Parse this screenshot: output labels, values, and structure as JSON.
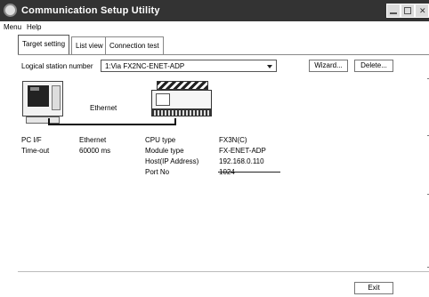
{
  "window": {
    "title": "Communication Setup Utility",
    "icons": {
      "app": "app-icon",
      "minimize": "minimize-icon",
      "maximize": "maximize-icon",
      "close": "close-icon"
    }
  },
  "menu": {
    "items": [
      "Menu",
      "Help"
    ]
  },
  "tabs": [
    {
      "label": "Target setting",
      "active": true
    },
    {
      "label": "List view",
      "active": false
    },
    {
      "label": "Connection test",
      "active": false
    }
  ],
  "target": {
    "station_label": "Logical station number",
    "station_value": "1:Via FX2NC-ENET-ADP",
    "wizard_label": "Wizard...",
    "delete_label": "Delete..."
  },
  "diagram": {
    "network_label": "Ethernet",
    "pc_icon": "pc-icon",
    "plc_icon": "plc-icon"
  },
  "details": {
    "pc_if_label": "PC I/F",
    "pc_if_value": "Ethernet",
    "timeout_label": "Time-out",
    "timeout_value": "60000 ms",
    "cpu_type_label": "CPU type",
    "cpu_type_value": "FX3N(C)",
    "module_type_label": "Module type",
    "module_type_value": "FX-ENET-ADP",
    "host_label": "Host(IP Address)",
    "host_value": "192.168.0.110",
    "port_label": "Port No",
    "port_value": "1024"
  },
  "footer": {
    "exit_label": "Exit"
  }
}
